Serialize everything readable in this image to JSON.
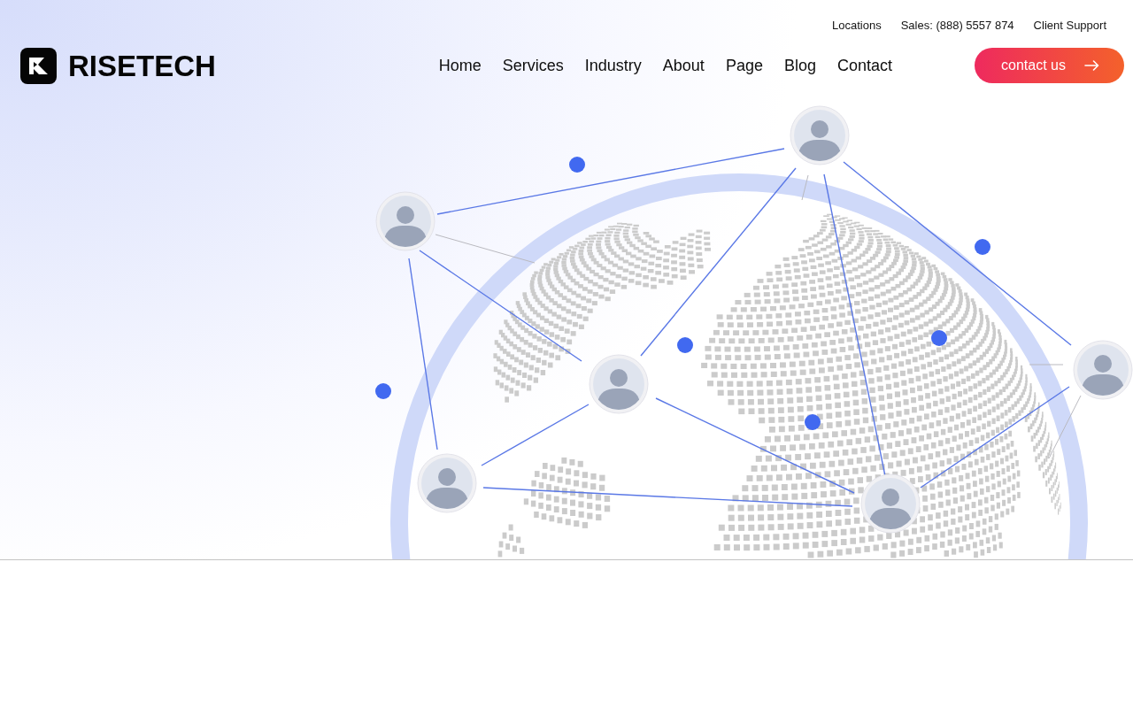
{
  "top_bar": {
    "links": [
      "Locations",
      "Sales: (888) 5557 874",
      "Client Support"
    ]
  },
  "header": {
    "logo": {
      "text": "RISETECH"
    },
    "nav": [
      "Home",
      "Services",
      "Industry",
      "About",
      "Page",
      "Blog",
      "Contact"
    ],
    "cta": {
      "label": "contact us"
    }
  }
}
